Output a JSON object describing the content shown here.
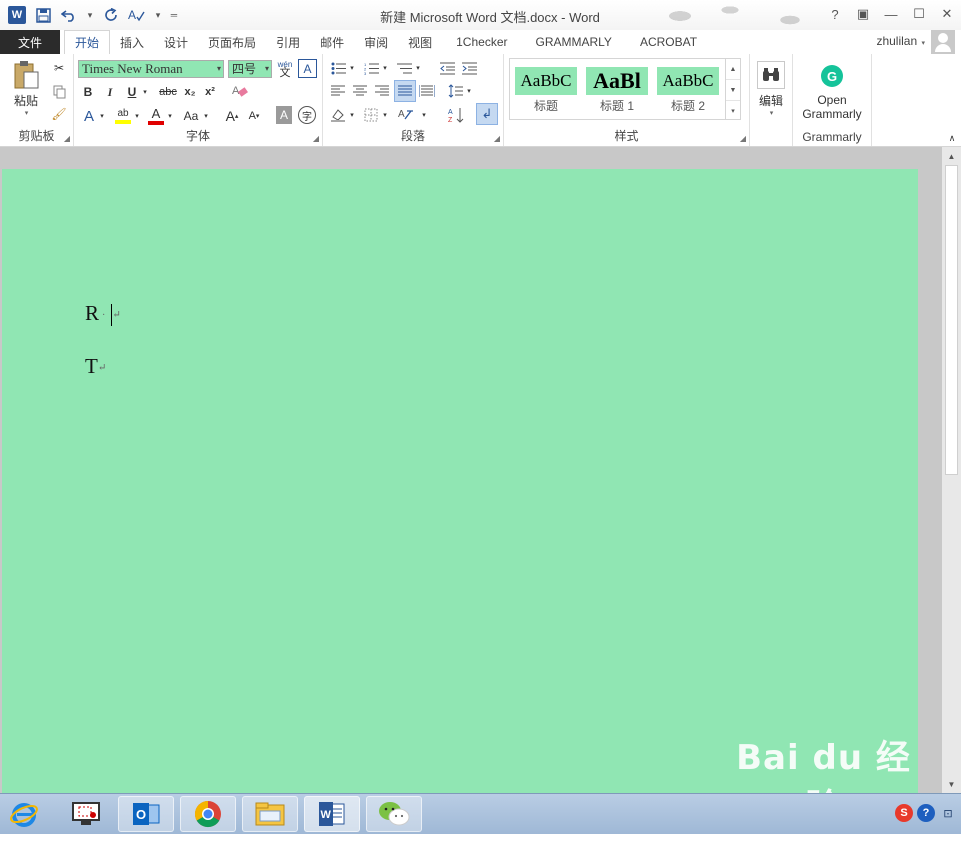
{
  "window": {
    "title": "新建 Microsoft Word 文档.docx - Word",
    "controls": [
      "?",
      "▣",
      "—",
      "☐",
      "✕"
    ]
  },
  "qat": {
    "app_icon": "W",
    "save_icon": "save-icon",
    "undo_icon": "undo-icon",
    "redo_icon": "redo-icon",
    "spell_icon": "spellcheck-icon"
  },
  "tabs": {
    "file": "文件",
    "items": [
      "开始",
      "插入",
      "设计",
      "页面布局",
      "引用",
      "邮件",
      "审阅",
      "视图",
      "1Checker",
      "GRAMMARLY",
      "ACROBAT"
    ],
    "active": "开始"
  },
  "user": {
    "name": "zhulilan"
  },
  "ribbon": {
    "clipboard": {
      "label": "剪贴板",
      "paste": "粘贴"
    },
    "font": {
      "label": "字体",
      "font_name": "Times New Roman",
      "font_size": "四号",
      "wen": "wén",
      "bold": "B",
      "italic": "I",
      "underline": "U",
      "strike": "abc",
      "subscript": "x₂",
      "superscript": "x²",
      "grow": "A",
      "shrink": "A",
      "case": "Aa"
    },
    "paragraph": {
      "label": "段落"
    },
    "styles": {
      "label": "样式",
      "items": [
        {
          "sample": "AaBbC",
          "name": "标题"
        },
        {
          "sample": "AaBl",
          "name": "标题 1"
        },
        {
          "sample": "AaBbC",
          "name": "标题 2"
        }
      ]
    },
    "editing": {
      "label": "编辑"
    },
    "grammarly": {
      "button_line1": "Open",
      "button_line2": "Grammarly",
      "label": "Grammarly"
    }
  },
  "document": {
    "paragraphs": [
      {
        "text": "R",
        "mark": "·",
        "return": "↵"
      },
      {
        "text": "T",
        "return": "↵"
      }
    ],
    "page_color": "#90e6b3"
  },
  "watermark": {
    "line1": "Bai du 经验",
    "line2": "jingyan.baidu.com"
  },
  "taskbar": {
    "apps": [
      "internet-explorer-icon",
      "screenshot-tool-icon",
      "outlook-icon",
      "chrome-icon",
      "file-explorer-icon",
      "word-icon",
      "wechat-icon"
    ],
    "tray": [
      "sogou-icon",
      "help-icon",
      "network-icon"
    ]
  }
}
